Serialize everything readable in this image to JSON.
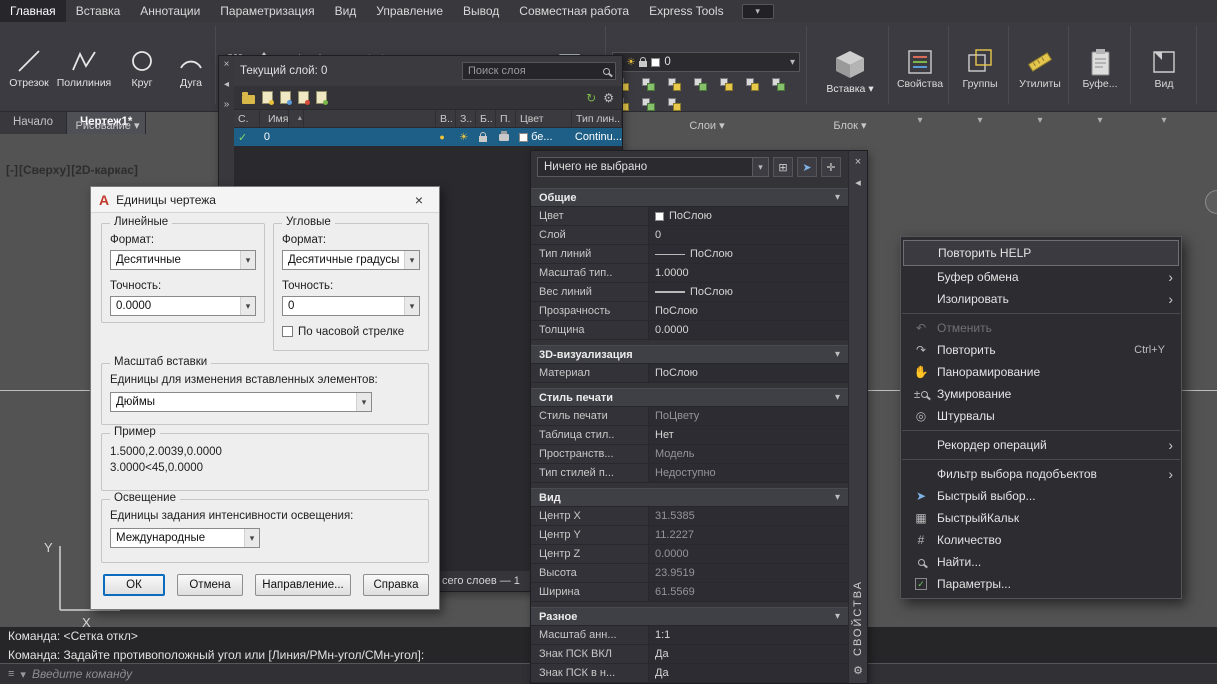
{
  "icons": {
    "close": "×",
    "dropdown": "▾",
    "submenu": "›",
    "collapse": "»",
    "pin": "◂",
    "sort": "▲",
    "undo": "↶",
    "redo": "↷",
    "pan": "✋",
    "zoom_pm": "±",
    "wheel": "◎",
    "calc": "▦",
    "count": "#",
    "check": "✓",
    "quickselect": "➤",
    "refresh": "↻",
    "gear": "⚙",
    "sun": "☀",
    "bulb": "●",
    "menu_lines": "≡",
    "pickadd": "⊞",
    "select_cross": "✛",
    "big_a": "А"
  },
  "colors": {
    "selected_row_blue": "#1d5f87",
    "canvas_gray": "#535353",
    "accent_yellow": "#f2c63c",
    "focus_blue": "#0b6bbd"
  },
  "menubar": {
    "tabs": [
      "Главная",
      "Вставка",
      "Аннотации",
      "Параметризация",
      "Вид",
      "Управление",
      "Вывод",
      "Совместная работа",
      "Express Tools"
    ]
  },
  "ribbon": {
    "draw_tools": [
      "Отрезок",
      "Полилиния",
      "Круг",
      "Дуга"
    ],
    "panel_labels": {
      "draw": "Рисование",
      "layers": "Слои",
      "block": "Блок"
    },
    "insert_button": "Вставка",
    "layer_combo_value": "0",
    "collapsed_panels": [
      "Свойства",
      "Группы",
      "Утилиты",
      "Буфе...",
      "Вид"
    ]
  },
  "file_tabs": [
    "Начало",
    "Чертеж1*"
  ],
  "viewport": {
    "controls": "[-]",
    "view": "[Сверху]",
    "style": "[2D-каркас]"
  },
  "ucs": {
    "x": "X",
    "y": "Y"
  },
  "layer_palette": {
    "current_layer": "Текущий слой: 0",
    "search_placeholder": "Поиск слоя",
    "columns": [
      "С.",
      "Имя",
      "В..",
      "З..",
      "Б..",
      "П.",
      "Цвет",
      "Тип лин.."
    ],
    "row": {
      "name": "0",
      "color": "бе...",
      "linetype": "Continu..."
    },
    "status": "сего слоев — 1"
  },
  "units_dialog": {
    "logo": "A",
    "title": "Единицы чертежа",
    "linear": {
      "group": "Линейные",
      "format_label": "Формат:",
      "format": "Десятичные",
      "precision_label": "Точность:",
      "precision": "0.0000"
    },
    "angular": {
      "group": "Угловые",
      "format_label": "Формат:",
      "format": "Десятичные градусы",
      "precision_label": "Точность:",
      "precision": "0",
      "clockwise": "По часовой стрелке"
    },
    "insertion": {
      "group": "Масштаб вставки",
      "caption": "Единицы для изменения вставленных элементов:",
      "value": "Дюймы"
    },
    "sample": {
      "group": "Пример",
      "line1": "1.5000,2.0039,0.0000",
      "line2": "3.0000<45,0.0000"
    },
    "lighting": {
      "group": "Освещение",
      "caption": "Единицы задания интенсивности освещения:",
      "value": "Международные"
    },
    "buttons": {
      "ok": "ОК",
      "cancel": "Отмена",
      "direction": "Направление...",
      "help": "Справка"
    }
  },
  "properties": {
    "selector": "Ничего не выбрано",
    "palette_title": "СВОЙСТВА",
    "sections": [
      {
        "title": "Общие",
        "rows": [
          {
            "label": "Цвет",
            "value": "ПоСлою"
          },
          {
            "label": "Слой",
            "value": "0"
          },
          {
            "label": "Тип линий",
            "value": "ПоСлою"
          },
          {
            "label": "Масштаб тип..",
            "value": "1.0000"
          },
          {
            "label": "Вес линий",
            "value": "ПоСлою"
          },
          {
            "label": "Прозрачность",
            "value": "ПоСлою"
          },
          {
            "label": "Толщина",
            "value": "0.0000"
          }
        ]
      },
      {
        "title": "3D-визуализация",
        "rows": [
          {
            "label": "Материал",
            "value": "ПоСлою"
          }
        ]
      },
      {
        "title": "Стиль печати",
        "rows": [
          {
            "label": "Стиль печати",
            "value": "ПоЦвету"
          },
          {
            "label": "Таблица стил..",
            "value": "Нет"
          },
          {
            "label": "Пространств...",
            "value": "Модель"
          },
          {
            "label": "Тип стилей п...",
            "value": "Недоступно"
          }
        ]
      },
      {
        "title": "Вид",
        "rows": [
          {
            "label": "Центр X",
            "value": "31.5385"
          },
          {
            "label": "Центр Y",
            "value": "11.2227"
          },
          {
            "label": "Центр Z",
            "value": "0.0000"
          },
          {
            "label": "Высота",
            "value": "23.9519"
          },
          {
            "label": "Ширина",
            "value": "61.5569"
          }
        ]
      },
      {
        "title": "Разное",
        "rows": [
          {
            "label": "Масштаб анн...",
            "value": "1:1"
          },
          {
            "label": "Знак ПСК ВКЛ",
            "value": "Да"
          },
          {
            "label": "Знак ПСК в н...",
            "value": "Да"
          }
        ]
      }
    ]
  },
  "context_menu": {
    "items": [
      {
        "label": "Повторить HELP"
      },
      {
        "label": "Буфер обмена"
      },
      {
        "label": "Изолировать"
      },
      {
        "label": "Отменить"
      },
      {
        "label": "Повторить",
        "shortcut": "Ctrl+Y"
      },
      {
        "label": "Панорамирование"
      },
      {
        "label": "Зумирование"
      },
      {
        "label": "Штурвалы"
      },
      {
        "label": "Рекордер операций"
      },
      {
        "label": "Фильтр выбора подобъектов"
      },
      {
        "label": "Быстрый выбор..."
      },
      {
        "label": "БыстрыйКальк"
      },
      {
        "label": "Количество"
      },
      {
        "label": "Найти..."
      },
      {
        "label": "Параметры..."
      }
    ]
  },
  "command_line": {
    "history1": "Команда: <Сетка откл>",
    "history2": "Команда: Задайте противоположный угол или [Линия/РМн-угол/СМн-угол]:",
    "placeholder": "Введите команду"
  }
}
